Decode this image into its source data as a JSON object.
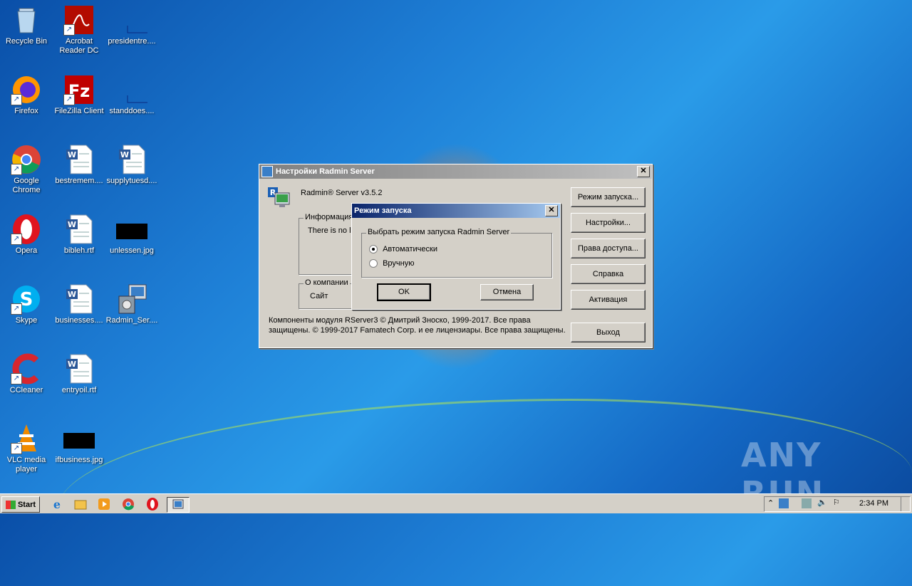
{
  "desktop": {
    "icons": [
      {
        "label": "Recycle Bin",
        "icon": "recycle-bin-icon"
      },
      {
        "label": "Acrobat Reader DC",
        "icon": "acrobat-icon"
      },
      {
        "label": "presidentre....",
        "icon": "file-icon"
      },
      {
        "label": "Firefox",
        "icon": "firefox-icon"
      },
      {
        "label": "FileZilla Client",
        "icon": "filezilla-icon"
      },
      {
        "label": "standdoes....",
        "icon": "file-icon"
      },
      {
        "label": "Google Chrome",
        "icon": "chrome-icon"
      },
      {
        "label": "bestremem....",
        "icon": "word-doc-icon"
      },
      {
        "label": "supplytuesd....",
        "icon": "word-doc-icon"
      },
      {
        "label": "Opera",
        "icon": "opera-icon"
      },
      {
        "label": "bibleh.rtf",
        "icon": "word-doc-icon"
      },
      {
        "label": "unlessen.jpg",
        "icon": "image-file-icon"
      },
      {
        "label": "Skype",
        "icon": "skype-icon"
      },
      {
        "label": "businesses....",
        "icon": "word-doc-icon"
      },
      {
        "label": "Radmin_Ser....",
        "icon": "radmin-installer-icon"
      },
      {
        "label": "CCleaner",
        "icon": "ccleaner-icon"
      },
      {
        "label": "entryoil.rtf",
        "icon": "word-doc-icon"
      },
      {
        "label": "VLC media player",
        "icon": "vlc-icon"
      },
      {
        "label": "ifbusiness.jpg",
        "icon": "image-file-icon"
      }
    ],
    "watermark": "ANY RUN"
  },
  "main_dialog": {
    "title": "Настройки Radmin Server",
    "product": "Radmin® Server v3.5.2",
    "info_group": "Информация",
    "info_text": "There is no li",
    "about_group": "О компании",
    "site_link": "Сайт",
    "copyright_1": "Компоненты модуля RServer3 © Дмитрий Зноско, 1999-2017. Все права",
    "copyright_2": "защищены. © 1999-2017 Famatech Corp. и ее лицензиары. Все права защищены.",
    "buttons": {
      "startup_mode": "Режим запуска...",
      "settings": "Настройки...",
      "access_rights": "Права доступа...",
      "help": "Справка",
      "activation": "Активация",
      "exit": "Выход"
    }
  },
  "mode_dialog": {
    "title": "Режим запуска",
    "group_label": "Выбрать режим запуска Radmin Server",
    "options": [
      {
        "label": "Автоматически",
        "selected": true
      },
      {
        "label": "Вручную",
        "selected": false
      }
    ],
    "ok": "OK",
    "cancel": "Отмена"
  },
  "taskbar": {
    "start": "Start",
    "time": "2:34 PM"
  },
  "colors": {
    "dialog_bg": "#d4d0c8",
    "active_title": "#0a246a",
    "inactive_title": "#808080"
  }
}
